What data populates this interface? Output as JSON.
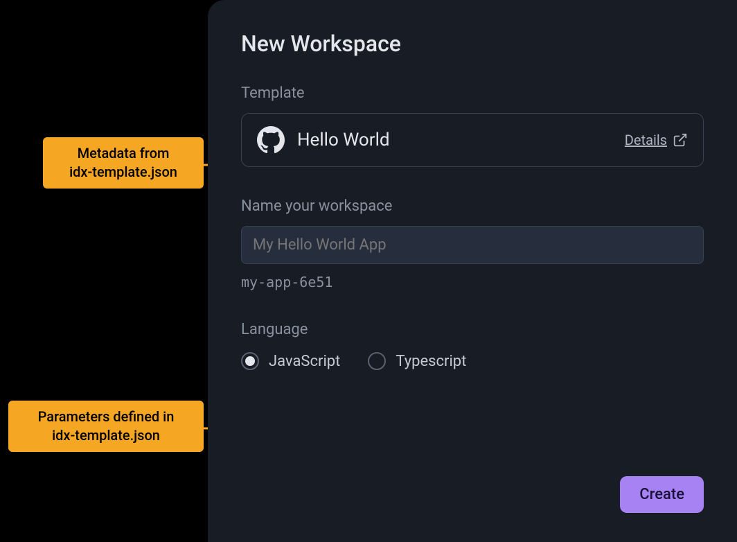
{
  "title": "New Workspace",
  "sections": {
    "template": {
      "label": "Template",
      "card": {
        "name": "Hello World",
        "details_label": "Details"
      }
    },
    "workspace_name": {
      "label": "Name your workspace",
      "placeholder": "My Hello World App",
      "slug": "my-app-6e51"
    },
    "language": {
      "label": "Language",
      "options": [
        {
          "label": "JavaScript",
          "selected": true
        },
        {
          "label": "Typescript",
          "selected": false
        }
      ]
    }
  },
  "create_button": "Create",
  "callouts": [
    {
      "line1": "Metadata from",
      "line2": "idx-template.json"
    },
    {
      "line1": "Parameters defined in",
      "line2": "idx-template.json"
    }
  ],
  "colors": {
    "panel_bg": "#171c25",
    "accent": "#a782f2",
    "callout": "#f5a623"
  }
}
